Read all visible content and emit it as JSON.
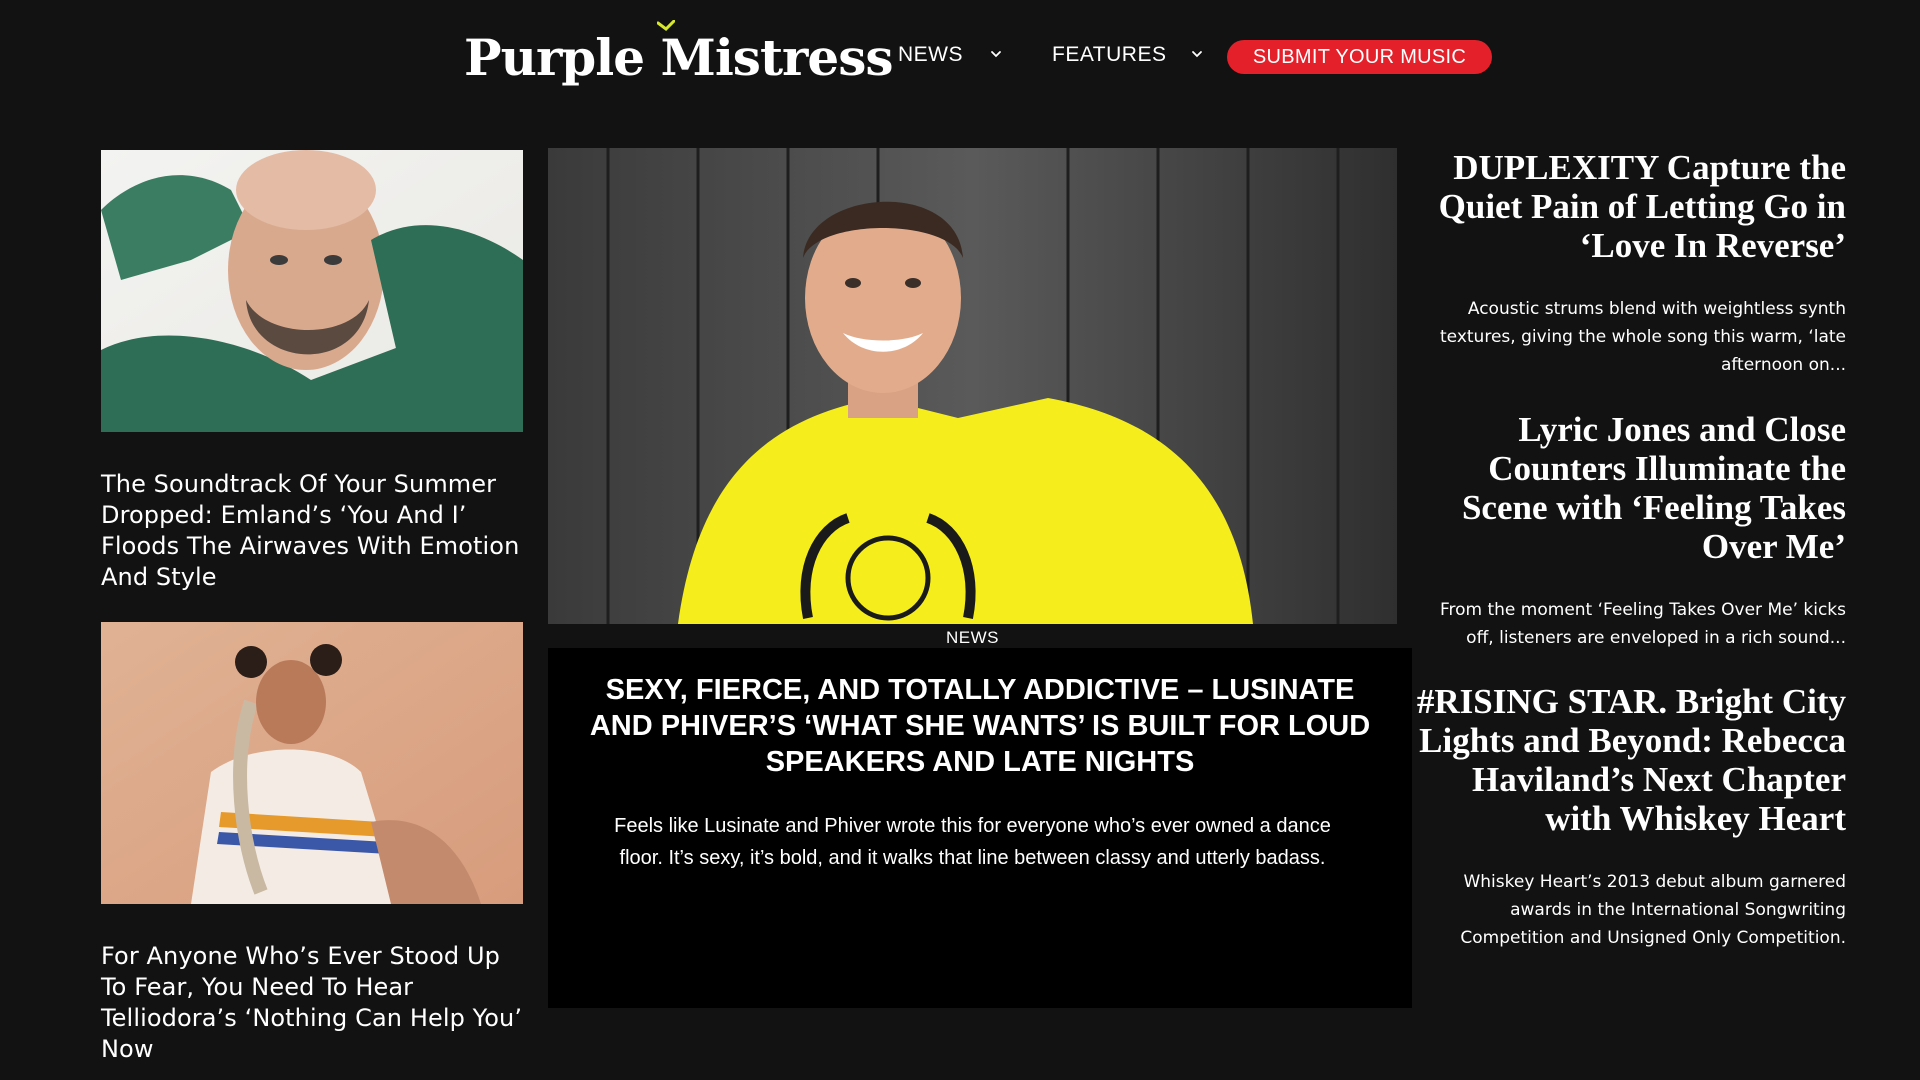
{
  "header": {
    "logo_text": "Purple Mistress",
    "nav": [
      {
        "label": "NEWS"
      },
      {
        "label": "FEATURES"
      }
    ],
    "submit_label": "SUBMIT YOUR MUSIC"
  },
  "colors": {
    "background": "#121213",
    "accent_red": "#e4202a",
    "logo_accent": "#d7e82a",
    "feature_shirt": "#f5ee1c"
  },
  "left_column": [
    {
      "title": "The Soundtrack Of Your Summer Dropped: Emland’s ‘You And I’ Floods The Airwaves With Emotion And Style"
    },
    {
      "title": "For Anyone Who’s Ever Stood Up To Fear, You Need To Hear Telliodora’s ‘Nothing Can Help You’ Now"
    }
  ],
  "feature": {
    "category": "NEWS",
    "title": "SEXY, FIERCE, AND TOTALLY ADDICTIVE – LUSINATE AND PHIVER’S ‘WHAT SHE WANTS’ IS BUILT FOR LOUD SPEAKERS AND LATE NIGHTS",
    "excerpt": "Feels like Lusinate and Phiver wrote this for everyone who’s ever owned a dance floor. It’s sexy, it’s bold, and it walks that line between classy and utterly badass."
  },
  "right_column": [
    {
      "title": "DUPLEXITY Capture the Quiet Pain of Letting Go in ‘Love In Reverse’",
      "excerpt": "Acoustic strums blend with weightless synth textures, giving the whole song this warm, ‘late afternoon on..."
    },
    {
      "title": "Lyric Jones and Close Counters Illuminate the Scene with ‘Feeling Takes Over Me’",
      "excerpt": "From the moment ‘Feeling Takes Over Me’ kicks off, listeners are enveloped in a rich sound..."
    },
    {
      "title": "#RISING STAR. Bright City Lights and Beyond: Rebecca Haviland’s Next Chapter with Whiskey Heart",
      "excerpt": "Whiskey Heart’s 2013 debut album garnered awards in the International Songwriting Competition and Unsigned Only Competition."
    }
  ]
}
